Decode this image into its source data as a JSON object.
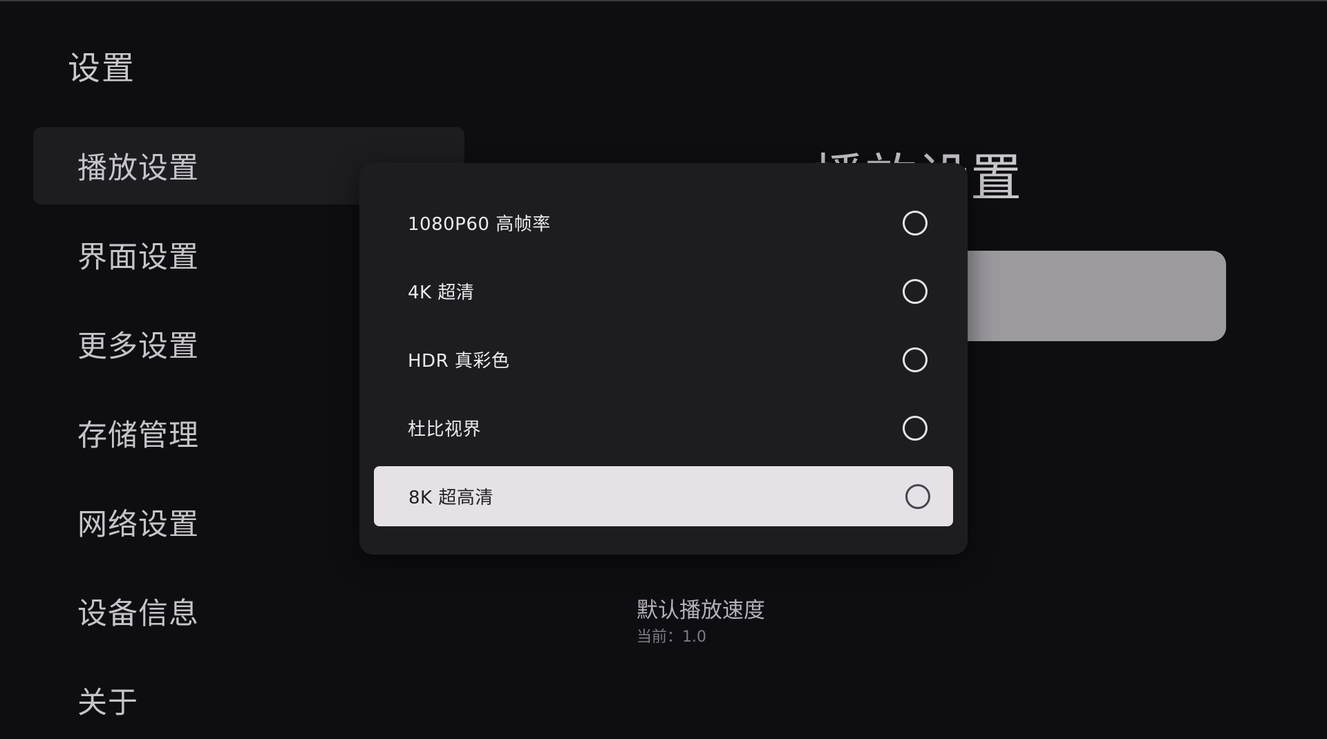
{
  "app": {
    "title": "设置"
  },
  "sidebar": {
    "items": [
      {
        "label": "播放设置",
        "active": true
      },
      {
        "label": "界面设置",
        "active": false
      },
      {
        "label": "更多设置",
        "active": false
      },
      {
        "label": "存储管理",
        "active": false
      },
      {
        "label": "网络设置",
        "active": false
      },
      {
        "label": "设备信息",
        "active": false
      },
      {
        "label": "关于",
        "active": false
      }
    ]
  },
  "main": {
    "section_title": "播放设置",
    "default_speed": {
      "label": "默认播放速度",
      "value": "当前：1.0"
    }
  },
  "dialog": {
    "options": [
      {
        "label": "1080P60 高帧率",
        "checked": false
      },
      {
        "label": "4K 超清",
        "checked": false
      },
      {
        "label": "HDR 真彩色",
        "checked": false
      },
      {
        "label": "杜比视界",
        "checked": false
      },
      {
        "label": "8K 超高清",
        "checked": false,
        "focused": true
      }
    ]
  },
  "colors": {
    "background": "#0e0d11",
    "surface": "#1d1c21",
    "focus_highlight": "#e6e1e6",
    "text_primary": "#eceaee",
    "text_secondary": "#c6c3c9"
  }
}
